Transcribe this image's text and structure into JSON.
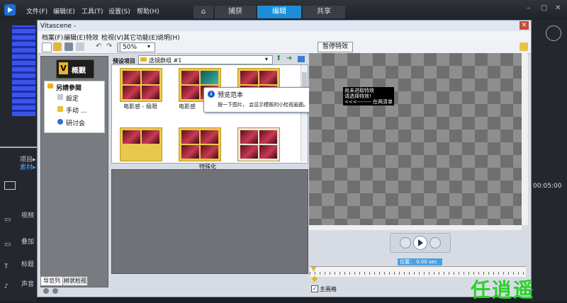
{
  "host": {
    "menu": [
      "文件(F)",
      "编辑(E)",
      "工具(T)",
      "设置(S)",
      "帮助(H)"
    ],
    "tabs": [
      "捕获",
      "编辑",
      "共享"
    ],
    "active_tab": "编辑",
    "window_controls": [
      "–",
      "▢",
      "✕"
    ],
    "left_labels": [
      "项目▸",
      "素材▸"
    ],
    "tracks": [
      "视频",
      "叠加",
      "标题",
      "声音"
    ],
    "right_time": "00:05:00",
    "accent_color": "#1a8fd8"
  },
  "vitascene": {
    "title": "Vitascene -",
    "menu": [
      "档案(F)",
      "编辑(E)",
      "特效",
      "检视(V)",
      "其它功能(E)",
      "说明(H)"
    ],
    "zoom": "50%",
    "pause_button": "暂停特效",
    "sidebar": {
      "logo_text": "概觀",
      "section": "另請參閱",
      "items": [
        "設定",
        "手动 ...",
        "研讨会"
      ],
      "tabs": [
        "导览列",
        "树状检视"
      ]
    },
    "gallery": {
      "preset_label": "预设项目",
      "folder": "选镜群组 #1",
      "captions": [
        "电影感 - 极限",
        "电影感"
      ],
      "tooltip_title": "预览范本",
      "tooltip_text": "按一下图片， 会显示模板的小检视画面。"
    },
    "lower_label": "特殊化",
    "preview_overlay": [
      "尚未进取特效",
      "请选择特效!",
      "<<<-------- 在两清单"
    ],
    "position_label": "位置： 0.00 sec",
    "keyframe_label": "主画格"
  },
  "watermark": "任逍遥"
}
